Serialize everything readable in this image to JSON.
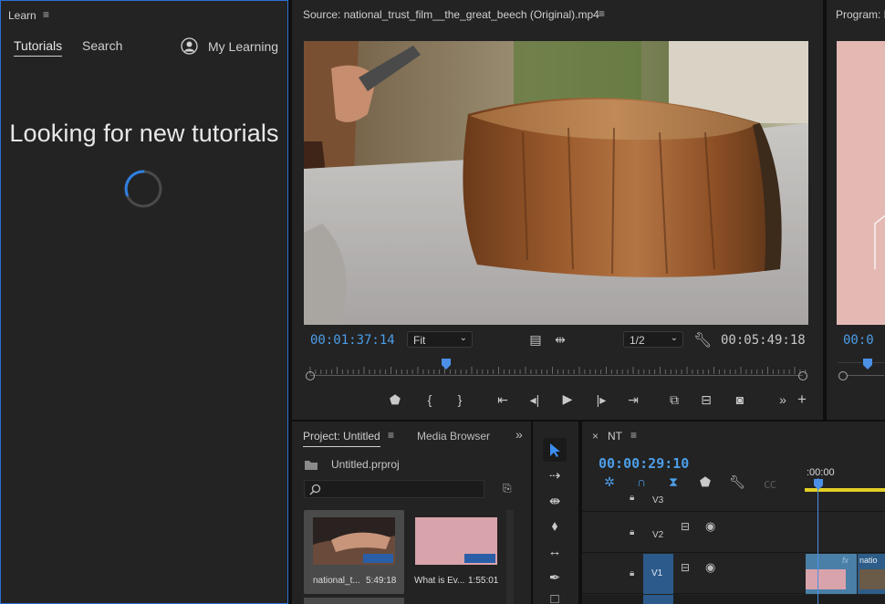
{
  "learn": {
    "panel_title": "Learn",
    "tabs": [
      {
        "label": "Tutorials"
      },
      {
        "label": "Search"
      }
    ],
    "my_learning": "My Learning",
    "heading": "Looking for new tutorials"
  },
  "source": {
    "title": "Source: national_trust_film__the_great_beech (Original).mp4",
    "timecode_current": "00:01:37:14",
    "zoom_value": "Fit",
    "resolution_value": "1/2",
    "timecode_duration": "00:05:49:18",
    "playhead_fraction": 0.28
  },
  "program": {
    "title": "Program: N",
    "timecode_partial": "00:0"
  },
  "project": {
    "tab_project": "Project: Untitled",
    "tab_media_browser": "Media Browser",
    "file_name": "Untitled.prproj",
    "items": [
      {
        "name": "national_t...",
        "duration": "5:49:18"
      },
      {
        "name": "What is Ev...",
        "duration": "1:55:01"
      }
    ]
  },
  "timeline": {
    "sequence_name": "NT",
    "timecode": "00:00:29:10",
    "ruler_label": ":00:00",
    "tracks": [
      {
        "label": "V3"
      },
      {
        "label": "V2"
      },
      {
        "label": "V1"
      }
    ],
    "clip_label": "natio",
    "fx_label": "fx"
  },
  "colors": {
    "accent": "#2f6fd6",
    "timecode_blue": "#4c9ee8",
    "panel_bg": "#232323",
    "clip_pink": "#d9a3ab"
  }
}
